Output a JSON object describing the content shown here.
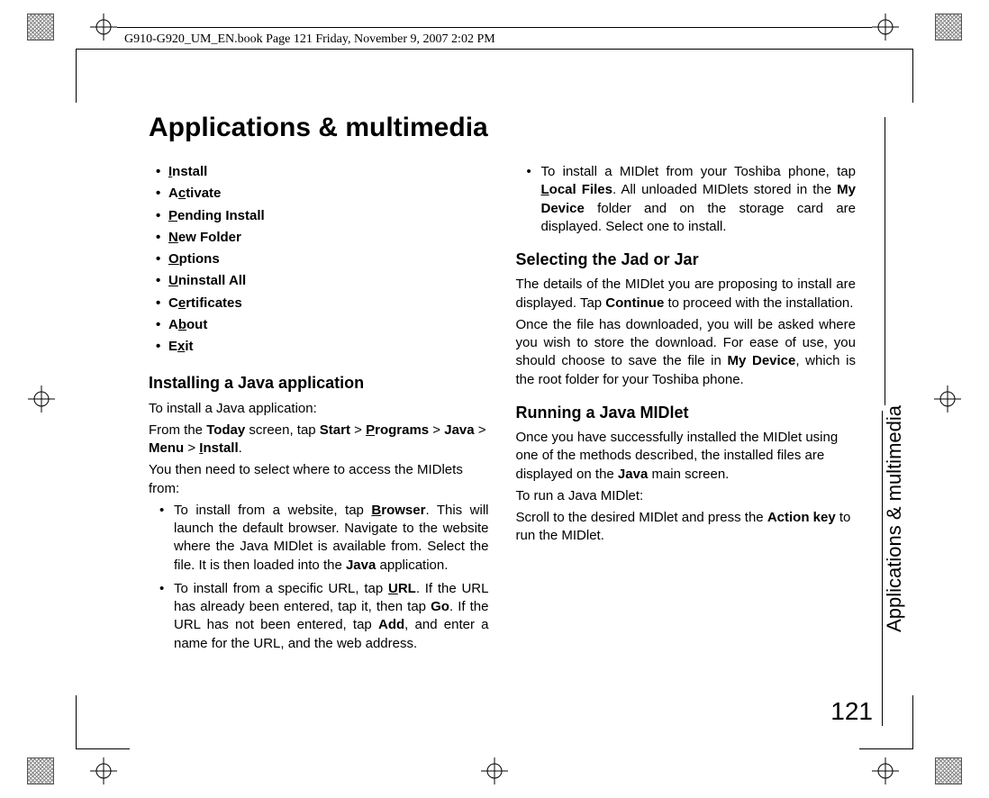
{
  "header": "G910-G920_UM_EN.book  Page 121  Friday, November 9, 2007  2:02 PM",
  "title": "Applications & multimedia",
  "side_label": "Applications & multimedia",
  "page_number": "121",
  "menu_items": [
    {
      "pre": "",
      "u": "I",
      "post": "nstall"
    },
    {
      "pre": "A",
      "u": "c",
      "post": "tivate"
    },
    {
      "pre": "",
      "u": "P",
      "post": "ending Install"
    },
    {
      "pre": "",
      "u": "N",
      "post": "ew Folder"
    },
    {
      "pre": "",
      "u": "O",
      "post": "ptions"
    },
    {
      "pre": "",
      "u": "U",
      "post": "ninstall All"
    },
    {
      "pre": "C",
      "u": "e",
      "post": "rtificates"
    },
    {
      "pre": "A",
      "u": "b",
      "post": "out"
    },
    {
      "pre": "E",
      "u": "x",
      "post": "it"
    }
  ],
  "left": {
    "h_install": "Installing a Java application",
    "p_intro": "To install a Java application:",
    "p_from_1a": "From the ",
    "p_from_today": "Today",
    "p_from_1b": " screen, tap ",
    "p_from_start": "Start",
    "gt": " > ",
    "p_from_programs_u": "P",
    "p_from_programs_rest": "rograms",
    "p_from_java": "Java",
    "p_from_menu": "Menu",
    "p_from_install_u": "I",
    "p_from_install_rest": "nstall",
    "p_from_dot": ".",
    "p_select": "You then need to select where to access the MIDlets from:",
    "li_browser_a": "To install from a website, tap ",
    "li_browser_u": "B",
    "li_browser_bold": "rowser",
    "li_browser_b": ". This will launch the default browser. Navigate to the website where the Java MIDlet is available from. Select the file. It is then loaded into the ",
    "li_browser_java": "Java",
    "li_browser_c": " application.",
    "li_url_a": "To install from a specific URL, tap ",
    "li_url_u": "U",
    "li_url_bold": "RL",
    "li_url_b": ". If the URL has already been entered, tap it, then tap ",
    "li_url_go": "Go",
    "li_url_c": ". If the URL has not been entered, tap ",
    "li_url_add": "Add",
    "li_url_d": ", and enter a name for the URL, and the web address."
  },
  "right": {
    "li_local_a": "To install a MIDlet from your Toshiba phone, tap ",
    "li_local_u": "L",
    "li_local_bold": "ocal Files",
    "li_local_b": ". All unloaded MIDlets stored in the ",
    "li_local_mydev": "My Device",
    "li_local_c": " folder and on the storage card are displayed. Select one to install.",
    "h_jad": "Selecting the Jad or Jar",
    "p_jad_a": "The details of the MIDlet you are proposing to install are displayed. Tap ",
    "p_jad_continue": "Continue",
    "p_jad_b": " to proceed with the installation.",
    "p_jad2_a": "Once the file has downloaded, you will be asked where you wish to store the download. For ease of use, you should choose to save the file in ",
    "p_jad2_mydev": "My Device",
    "p_jad2_b": ", which is the root folder for your Toshiba phone.",
    "h_run": "Running a Java MIDlet",
    "p_run_a": "Once you have successfully installed the MIDlet using one of the methods described, the installed files are displayed on the ",
    "p_run_java": "Java",
    "p_run_b": " main screen.",
    "p_run2": "To run a Java MIDlet:",
    "p_run3_a": "Scroll to the desired MIDlet and press the ",
    "p_run3_action": "Action key",
    "p_run3_b": " to run the MIDlet."
  }
}
